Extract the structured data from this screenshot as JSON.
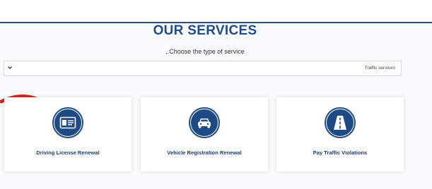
{
  "header": {
    "title": "OUR SERVICES",
    "subtitle": "..Choose the type of service"
  },
  "service_select": {
    "selected": "Traffic services"
  },
  "cards": [
    {
      "label": "Driving License Renewal",
      "icon": "license-card-icon"
    },
    {
      "label": "Vehicle Registration Renewal",
      "icon": "car-icon"
    },
    {
      "label": "Pay Traffic Violations",
      "icon": "road-icon"
    }
  ],
  "colors": {
    "brand_blue": "#1e4a86",
    "title_blue": "#1f4c8c",
    "arrow_red": "#d7261e"
  }
}
